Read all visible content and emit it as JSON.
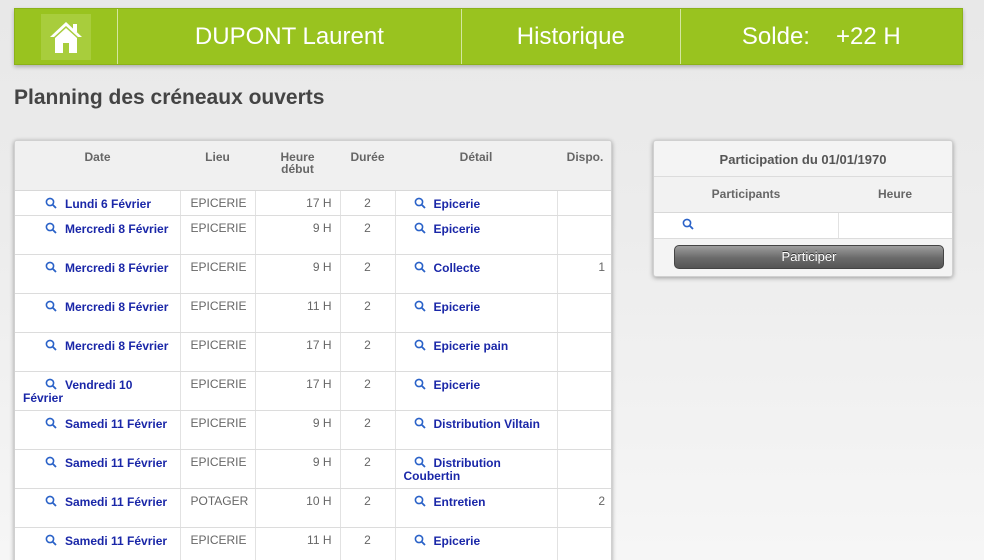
{
  "header": {
    "home_icon": "house-icon",
    "user_name": "DUPONT Laurent",
    "historique_label": "Historique",
    "solde_label": "Solde:",
    "solde_value": "+22 H",
    "accent_color": "#99c31f"
  },
  "page_title": "Planning des créneaux ouverts",
  "planning": {
    "columns": [
      "Date",
      "Lieu",
      "Heure début",
      "Durée",
      "Détail",
      "Dispo."
    ],
    "rows": [
      {
        "date": "Lundi 6 Février",
        "lieu": "EPICERIE",
        "heure": "17 H",
        "duree": "2",
        "detail": "Epicerie",
        "dispo": ""
      },
      {
        "date": "Mercredi 8 Février",
        "lieu": "EPICERIE",
        "heure": "9 H",
        "duree": "2",
        "detail": "Epicerie",
        "dispo": ""
      },
      {
        "date": "Mercredi 8 Février",
        "lieu": "EPICERIE",
        "heure": "9 H",
        "duree": "2",
        "detail": "Collecte",
        "dispo": "1"
      },
      {
        "date": "Mercredi 8 Février",
        "lieu": "EPICERIE",
        "heure": "11 H",
        "duree": "2",
        "detail": "Epicerie",
        "dispo": ""
      },
      {
        "date": "Mercredi 8 Février",
        "lieu": "EPICERIE",
        "heure": "17 H",
        "duree": "2",
        "detail": "Epicerie pain",
        "dispo": ""
      },
      {
        "date": "Vendredi 10 Février",
        "lieu": "EPICERIE",
        "heure": "17 H",
        "duree": "2",
        "detail": "Epicerie",
        "dispo": ""
      },
      {
        "date": "Samedi 11 Février",
        "lieu": "EPICERIE",
        "heure": "9 H",
        "duree": "2",
        "detail": "Distribution Viltain",
        "dispo": ""
      },
      {
        "date": "Samedi 11 Février",
        "lieu": "EPICERIE",
        "heure": "9 H",
        "duree": "2",
        "detail": "Distribution Coubertin",
        "dispo": ""
      },
      {
        "date": "Samedi 11 Février",
        "lieu": "POTAGER",
        "heure": "10 H",
        "duree": "2",
        "detail": "Entretien",
        "dispo": "2"
      },
      {
        "date": "Samedi 11 Février",
        "lieu": "EPICERIE",
        "heure": "11 H",
        "duree": "2",
        "detail": "Epicerie",
        "dispo": ""
      }
    ]
  },
  "participation": {
    "title": "Participation du 01/01/1970",
    "columns": [
      "Participants",
      "Heure"
    ],
    "button_label": "Participer"
  }
}
